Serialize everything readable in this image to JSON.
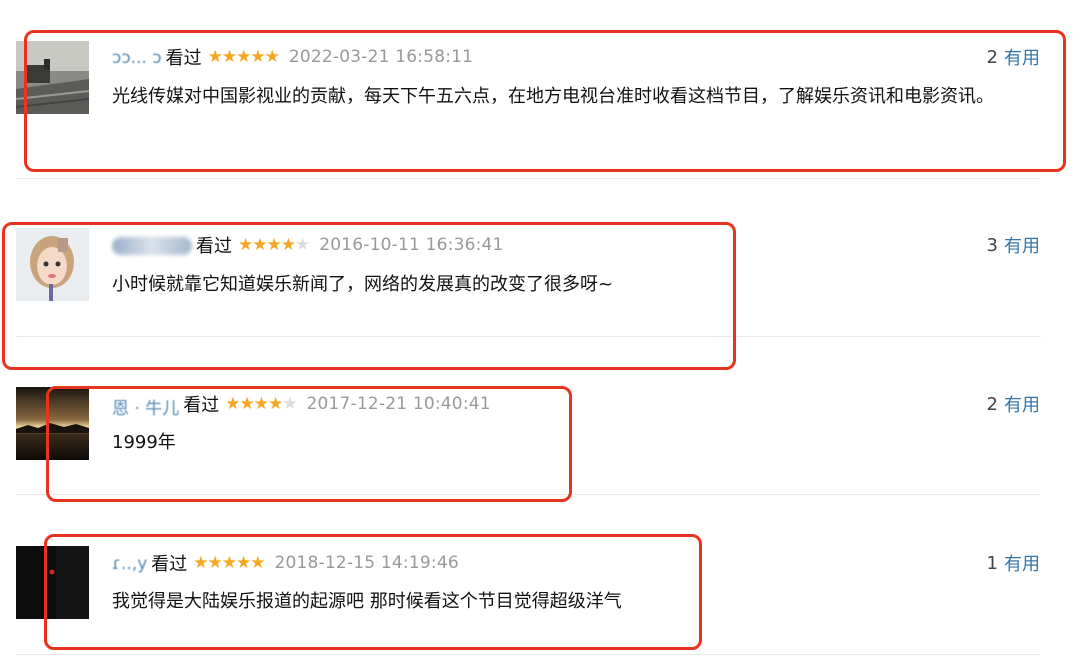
{
  "reviews": [
    {
      "username_visible": "ɔɔ... ɔ",
      "watched": "看过",
      "rating": 5,
      "stars_text": "★★★★★",
      "time": "2022-03-21 16:58:11",
      "votes_count": "2",
      "votes_label": "有用",
      "comment": "光线传媒对中国影视业的贡献，每天下午五六点，在地方电视台准时收看这档节目，了解娱乐资讯和电影资讯。"
    },
    {
      "username_visible": "",
      "watched": "看过",
      "rating": 4,
      "stars_on": "★★★★",
      "stars_off": "★",
      "time": "2016-10-11 16:36:41",
      "votes_count": "3",
      "votes_label": "有用",
      "comment": "小时候就靠它知道娱乐新闻了，网络的发展真的改变了很多呀~"
    },
    {
      "username_visible": "恩 · 牛儿",
      "watched": "看过",
      "rating": 4,
      "stars_on": "★★★★",
      "stars_off": "★",
      "time": "2017-12-21 10:40:41",
      "votes_count": "2",
      "votes_label": "有用",
      "comment": "1999年"
    },
    {
      "username_visible": "ɾ..,y",
      "watched": "看过",
      "rating": 5,
      "stars_text": "★★★★★",
      "time": "2018-12-15 14:19:46",
      "votes_count": "1",
      "votes_label": "有用",
      "comment": "我觉得是大陆娱乐报道的起源吧 那时候看这个节目觉得超级洋气"
    }
  ],
  "colors": {
    "highlight": "#e8341c",
    "star": "#f5a623",
    "link": "#3377aa",
    "time": "#999999"
  }
}
